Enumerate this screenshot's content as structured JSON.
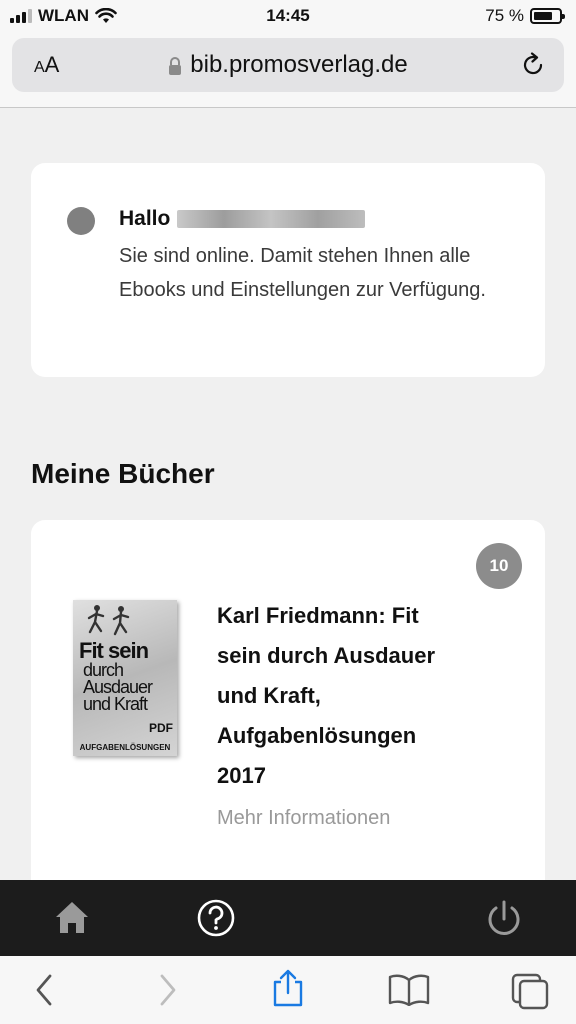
{
  "status_bar": {
    "carrier": "WLAN",
    "time": "14:45",
    "battery_percent": "75 %",
    "battery_level": 0.75
  },
  "browser": {
    "text_size_small": "A",
    "text_size_large": "A",
    "url": "bib.promosverlag.de"
  },
  "greeting": {
    "hello": "Hallo",
    "message": "Sie sind online. Damit stehen Ihnen alle Ebooks und Einstellungen zur Verfügung."
  },
  "books_section": {
    "title": "Meine Bücher",
    "books": [
      {
        "badge": "10",
        "title": "Karl Friedmann: Fit sein durch Ausdauer und Kraft, Aufgabenlösungen 2017",
        "more_link": "Mehr Informationen",
        "cover": {
          "title_line1": "Fit sein",
          "title_line2": "durch",
          "title_line3": "Ausdauer",
          "title_line4": "und Kraft",
          "format": "PDF",
          "subtitle": "AUFGABENLÖSUNGEN"
        }
      }
    ]
  },
  "app_bar": {
    "icons": [
      "home-icon",
      "help-icon",
      "power-icon"
    ]
  },
  "safari_toolbar": {
    "icons": [
      "back-icon",
      "forward-icon",
      "share-icon",
      "bookmarks-icon",
      "tabs-icon"
    ]
  }
}
